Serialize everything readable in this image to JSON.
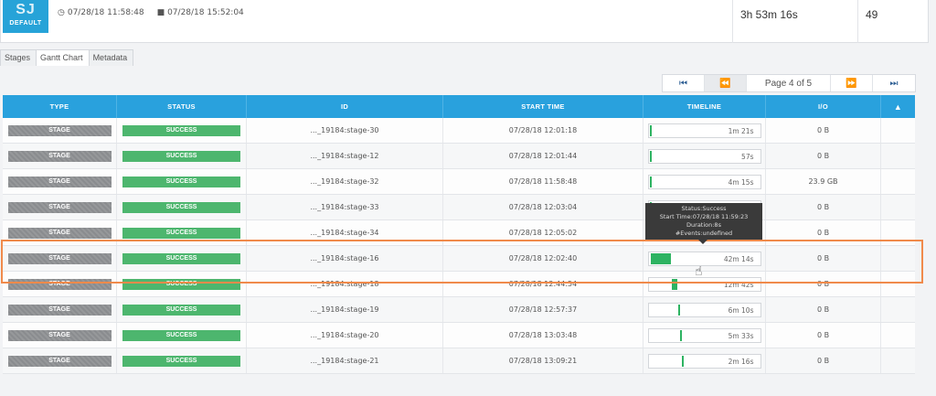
{
  "header": {
    "badge_initials": "SJ",
    "badge_label": "DEFAULT",
    "start_time": "07/28/18 11:58:48",
    "end_time": "07/28/18 15:52:04",
    "duration": "3h 53m 16s",
    "count": "49"
  },
  "tabs": [
    {
      "label": "Stages",
      "active": false
    },
    {
      "label": "Gantt Chart",
      "active": true
    },
    {
      "label": "Metadata",
      "active": false
    }
  ],
  "pager": {
    "label": "Page 4 of 5"
  },
  "table": {
    "headers": {
      "type": "TYPE",
      "status": "STATUS",
      "id": "ID",
      "start": "START TIME",
      "timeline": "TIMELINE",
      "io": "I/O"
    },
    "rows": [
      {
        "type": "STAGE",
        "status": "SUCCESS",
        "id": "..._19184:stage-30",
        "start": "07/28/18 12:01:18",
        "duration": "1m 21s",
        "fill_start": 0.0,
        "fill_width": 0.01,
        "io": "0 B"
      },
      {
        "type": "STAGE",
        "status": "SUCCESS",
        "id": "..._19184:stage-12",
        "start": "07/28/18 12:01:44",
        "duration": "57s",
        "fill_start": 0.0,
        "fill_width": 0.01,
        "io": "0 B"
      },
      {
        "type": "STAGE",
        "status": "SUCCESS",
        "id": "..._19184:stage-32",
        "start": "07/28/18 11:58:48",
        "duration": "4m 15s",
        "fill_start": 0.0,
        "fill_width": 0.02,
        "io": "23.9 GB"
      },
      {
        "type": "STAGE",
        "status": "SUCCESS",
        "id": "..._19184:stage-33",
        "start": "07/28/18 12:03:04",
        "duration": "",
        "fill_start": 0.0,
        "fill_width": 0.01,
        "io": "0 B"
      },
      {
        "type": "STAGE",
        "status": "SUCCESS",
        "id": "..._19184:stage-34",
        "start": "07/28/18 12:05:02",
        "duration": "",
        "fill_start": 0.0,
        "fill_width": 0.01,
        "io": "0 B"
      },
      {
        "type": "STAGE",
        "status": "SUCCESS",
        "id": "..._19184:stage-16",
        "start": "07/28/18 12:02:40",
        "duration": "42m 14s",
        "fill_start": 0.01,
        "fill_width": 0.18,
        "io": "0 B"
      },
      {
        "type": "STAGE",
        "status": "SUCCESS",
        "id": "..._19184:stage-18",
        "start": "07/28/18 12:44:54",
        "duration": "12m 42s",
        "fill_start": 0.2,
        "fill_width": 0.05,
        "io": "0 B"
      },
      {
        "type": "STAGE",
        "status": "SUCCESS",
        "id": "..._19184:stage-19",
        "start": "07/28/18 12:57:37",
        "duration": "6m 10s",
        "fill_start": 0.25,
        "fill_width": 0.02,
        "io": "0 B"
      },
      {
        "type": "STAGE",
        "status": "SUCCESS",
        "id": "..._19184:stage-20",
        "start": "07/28/18 13:03:48",
        "duration": "5m 33s",
        "fill_start": 0.27,
        "fill_width": 0.02,
        "io": "0 B"
      },
      {
        "type": "STAGE",
        "status": "SUCCESS",
        "id": "..._19184:stage-21",
        "start": "07/28/18 13:09:21",
        "duration": "2m 16s",
        "fill_start": 0.29,
        "fill_width": 0.01,
        "io": "0 B"
      }
    ]
  },
  "tooltip": {
    "line1": "Status:Success",
    "line2": "Start Time:07/28/18 11:59:23",
    "line3": "Duration:8s",
    "line4": "#Events:undefined"
  },
  "colors": {
    "accent": "#29a1dd",
    "success": "#4db66e",
    "timeline": "#2eb362",
    "highlight": "#f08a4b"
  }
}
